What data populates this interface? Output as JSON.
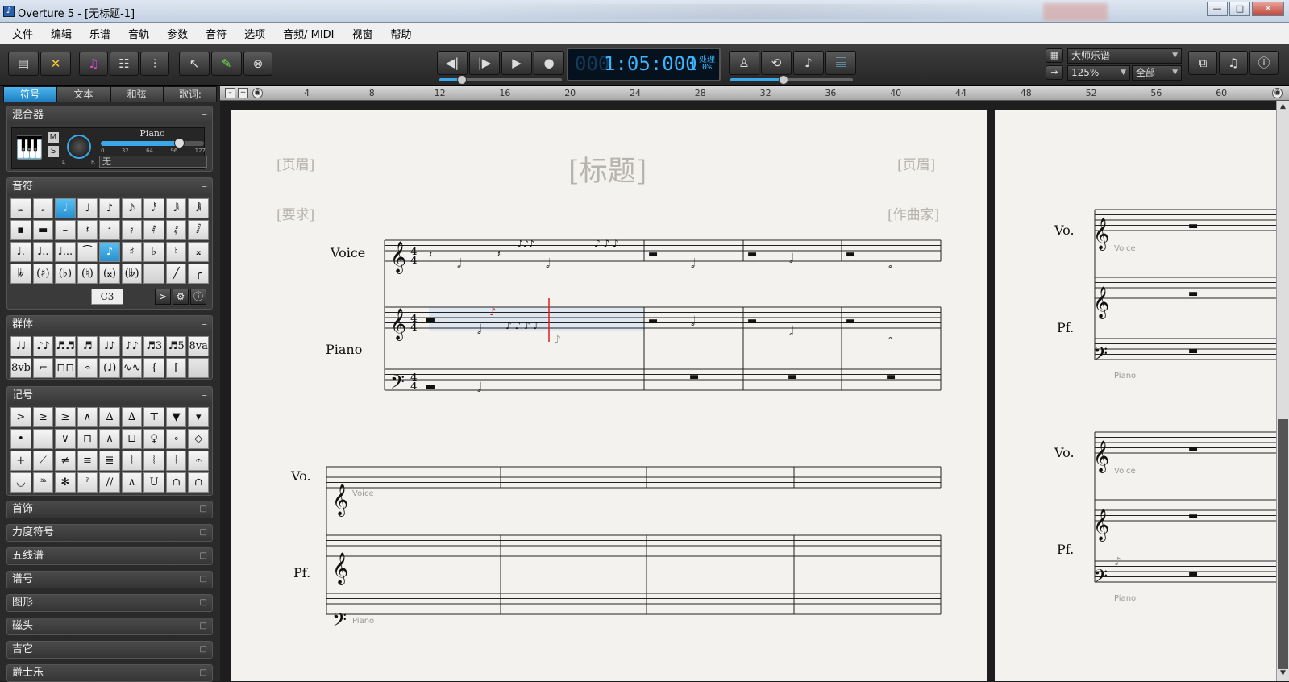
{
  "window": {
    "title": "Overture 5 - [无标题-1]",
    "minimize": "—",
    "maximize": "□",
    "close": "✕"
  },
  "menu": [
    "文件",
    "编辑",
    "乐谱",
    "音轨",
    "参数",
    "音符",
    "选项",
    "音频/ MIDI",
    "视窗",
    "帮助"
  ],
  "transport": {
    "counter": "1:05:000",
    "counter_dim": "000",
    "beat": "1",
    "processing_label": "处理",
    "processing_pct": "0%"
  },
  "toolbar_right": {
    "layout_preset": "大师乐谱",
    "zoom": "125%",
    "scope": "全部"
  },
  "palette_tabs": [
    "符号",
    "文本",
    "和弦",
    "歌词:"
  ],
  "mixer": {
    "header": "混合器",
    "instrument": "Piano",
    "mute": "M",
    "solo": "S",
    "pan_l": "L",
    "pan_r": "R",
    "scale": [
      "0",
      "32",
      "64",
      "96",
      "127"
    ],
    "volume_fraction": 0.76,
    "effect": "无"
  },
  "notes_panel": {
    "header": "音符",
    "rows": [
      [
        "𝅜",
        "𝅝",
        "𝅗𝅥",
        "♩",
        "♪",
        "𝅘𝅥𝅯",
        "𝅘𝅥𝅰",
        "𝅘𝅥𝅱",
        "𝅘𝅥𝅲"
      ],
      [
        "▪",
        "▬",
        "–",
        "𝄽",
        "𝄾",
        "𝄿",
        "𝅀",
        "𝅁",
        "𝅂"
      ],
      [
        "♩.",
        "♩..",
        "♩...",
        "⁀",
        "♪",
        "♯",
        "♭",
        "♮",
        "𝄪"
      ],
      [
        "𝄫",
        "(♯)",
        "(♭)",
        "(♮)",
        "(𝄪)",
        "(𝄫)",
        "",
        "╱",
        "╭"
      ]
    ],
    "selected": [
      [
        0,
        2
      ],
      [
        2,
        4
      ]
    ],
    "pitch": "C3",
    "accent_btn": ">"
  },
  "groups_panel": {
    "header": "群体",
    "rows": [
      [
        "♩♩",
        "♪♪",
        "♬♬",
        "♬",
        "♩♪",
        "♪♪",
        "♬3",
        "♬5",
        "8va"
      ],
      [
        "8vb",
        "⌐",
        "⊓⊓",
        "𝄐",
        "(♩)",
        "∿∿",
        "{",
        "[",
        ""
      ]
    ]
  },
  "marks_panel": {
    "header": "记号",
    "rows": [
      [
        ">",
        "≥",
        "≥",
        "∧",
        "∆",
        "∆",
        "⊤",
        "▼",
        "▾"
      ],
      [
        "•",
        "—",
        "∨",
        "⊓",
        "∧",
        "⊔",
        "♀",
        "∘",
        "◇"
      ],
      [
        "+",
        "⟋",
        "≠",
        "≡",
        "≣",
        "⦚",
        "⦚",
        "⦚",
        "𝄐"
      ],
      [
        "◡",
        "𝆮",
        "✻",
        "ˀ",
        "//",
        "∧",
        "U",
        "∩",
        "∩"
      ]
    ]
  },
  "collapsed_panels": [
    "首饰",
    "力度符号",
    "五线谱",
    "谱号",
    "图形",
    "磁头",
    "吉它",
    "爵士乐"
  ],
  "ruler": [
    "4",
    "8",
    "12",
    "16",
    "20",
    "24",
    "28",
    "32",
    "36",
    "40",
    "44",
    "48",
    "52",
    "56",
    "60"
  ],
  "score": {
    "header_left": "[页眉]",
    "title": "[标题]",
    "header_right": "[页眉]",
    "subtitle_left": "[要求]",
    "composer": "[作曲家]",
    "system1": {
      "voice": "Voice",
      "piano": "Piano"
    },
    "system2": {
      "voice": "Vo.",
      "piano": "Pf.",
      "voice_small": "Voice",
      "piano_small": "Piano"
    },
    "page2": {
      "voice": "Vo.",
      "piano": "Pf.",
      "voice_small": "Voice",
      "piano_small": "Piano"
    }
  }
}
